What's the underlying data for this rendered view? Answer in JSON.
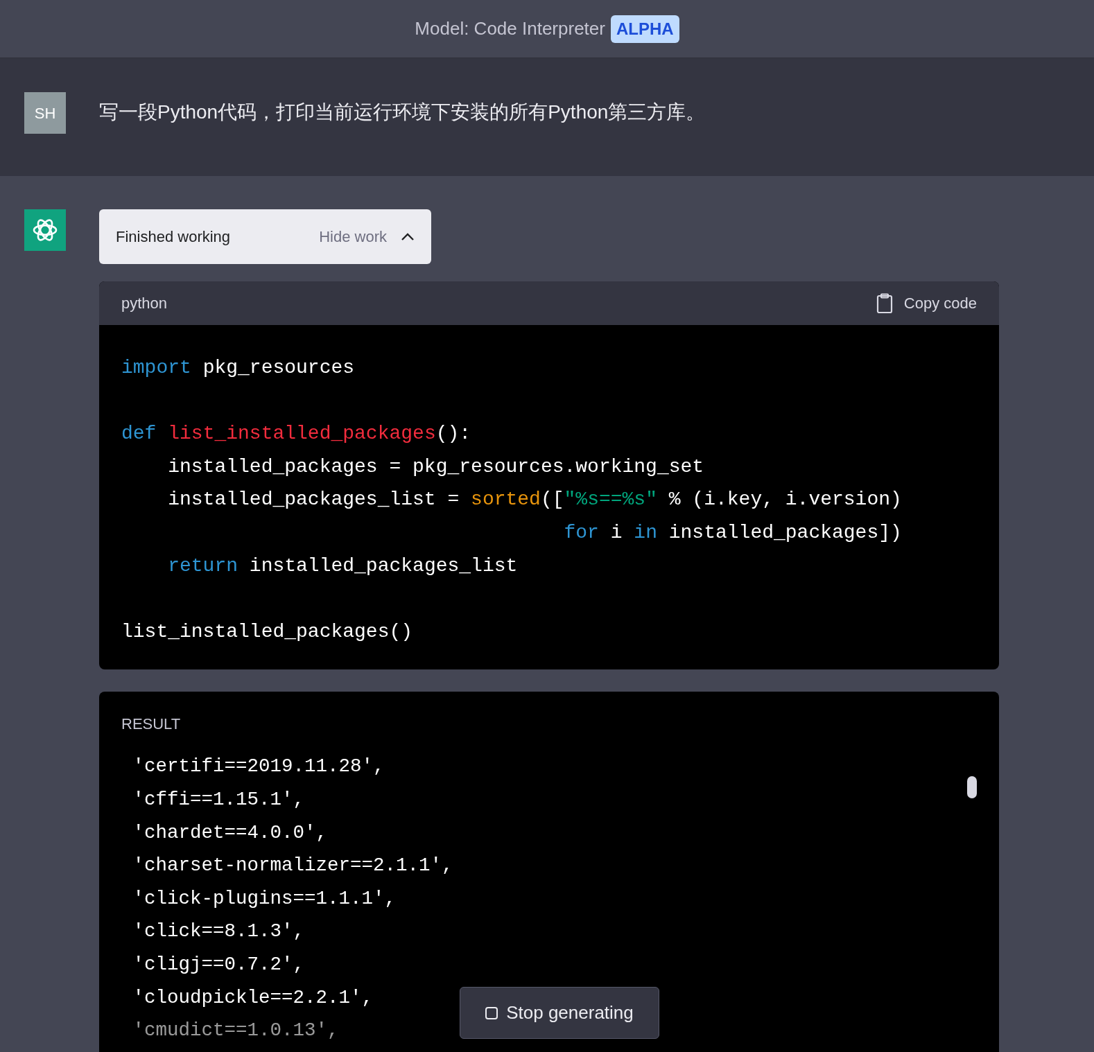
{
  "header": {
    "title": "Model: Code Interpreter",
    "badge": "ALPHA"
  },
  "user_message": {
    "avatar": "SH",
    "text": "写一段Python代码，打印当前运行环境下安装的所有Python第三方库。"
  },
  "work_panel": {
    "status": "Finished working",
    "toggle": "Hide work",
    "expanded": true
  },
  "code_block": {
    "language": "python",
    "copy_label": "Copy code",
    "lines": [
      {
        "kind": "code",
        "tokens": [
          {
            "kind": "keyword",
            "text": "import"
          },
          {
            "kind": "plain",
            "text": " pkg_resources"
          }
        ]
      },
      {
        "kind": "blank"
      },
      {
        "kind": "code",
        "tokens": [
          {
            "kind": "keyword",
            "text": "def"
          },
          {
            "kind": "function",
            "text": " list_installed_packages"
          },
          {
            "kind": "plain",
            "text": "():"
          }
        ]
      },
      {
        "kind": "code",
        "tokens": [
          {
            "kind": "plain",
            "text": "    installed_packages = pkg_resources.working_set"
          }
        ]
      },
      {
        "kind": "code",
        "tokens": [
          {
            "kind": "plain",
            "text": "    installed_packages_list = "
          },
          {
            "kind": "builtin",
            "text": "sorted"
          },
          {
            "kind": "plain",
            "text": "(["
          },
          {
            "kind": "string",
            "text": "\"%s==%s\""
          },
          {
            "kind": "plain",
            "text": " % (i.key, i.version)"
          }
        ]
      },
      {
        "kind": "code",
        "tokens": [
          {
            "kind": "keyword",
            "text": "                                      for"
          },
          {
            "kind": "plain",
            "text": " i "
          },
          {
            "kind": "keyword",
            "text": "in"
          },
          {
            "kind": "plain",
            "text": " installed_packages])"
          }
        ]
      },
      {
        "kind": "code",
        "tokens": [
          {
            "kind": "keyword",
            "text": "    return"
          },
          {
            "kind": "plain",
            "text": " installed_packages_list"
          }
        ]
      },
      {
        "kind": "blank"
      },
      {
        "kind": "code",
        "tokens": [
          {
            "kind": "plain",
            "text": "list_installed_packages()"
          }
        ]
      }
    ]
  },
  "result": {
    "label": "RESULT",
    "lines": [
      " 'certifi==2019.11.28',",
      " 'cffi==1.15.1',",
      " 'chardet==4.0.0',",
      " 'charset-normalizer==2.1.1',",
      " 'click-plugins==1.1.1',",
      " 'click==8.1.3',",
      " 'cligj==0.7.2',",
      " 'cloudpickle==2.2.1',",
      " 'cmudict==1.0.13',"
    ]
  },
  "stop_button": {
    "label": "Stop generating"
  }
}
